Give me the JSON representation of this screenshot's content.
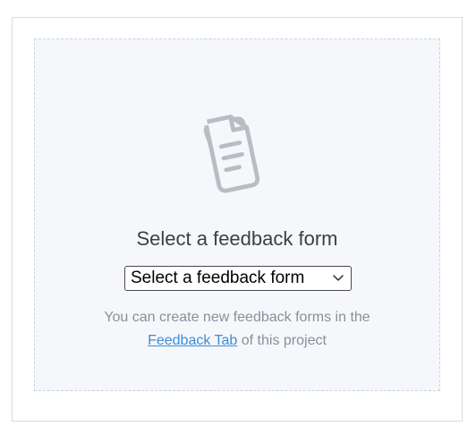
{
  "empty_state": {
    "icon": "documents-icon",
    "title": "Select a feedback form",
    "select": {
      "selected": "Select a feedback form",
      "icon": "chevron-down-icon"
    },
    "helper": {
      "text_before": "You can create new feedback forms in the",
      "link_text": "Feedback Tab",
      "text_after": "of this project"
    }
  },
  "colors": {
    "link": "#3b8fd3",
    "icon": "#b9bcc3",
    "panel_background": "#f6f7fb"
  }
}
